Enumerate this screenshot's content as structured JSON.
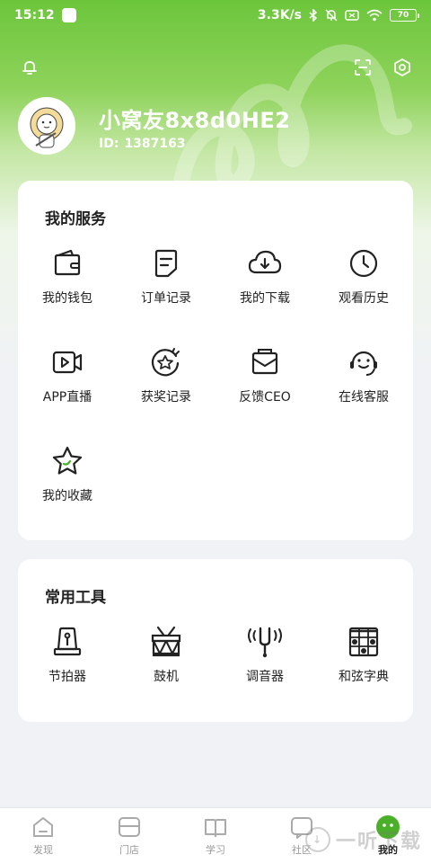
{
  "status_bar": {
    "time": "15:12",
    "network_speed": "3.3K/s",
    "battery": "70",
    "icons": [
      "app-notification-icon",
      "bluetooth-icon",
      "mute-icon",
      "sim-icon",
      "wifi-icon",
      "battery-icon"
    ]
  },
  "header": {
    "icons": [
      "bell-icon",
      "scan-icon",
      "settings-icon"
    ]
  },
  "profile": {
    "username": "小窝友8x8d0HE2",
    "id_label": "ID:",
    "id_value": "1387163"
  },
  "services": {
    "title": "我的服务",
    "items": [
      {
        "label": "我的钱包",
        "icon": "wallet-icon"
      },
      {
        "label": "订单记录",
        "icon": "order-icon"
      },
      {
        "label": "我的下载",
        "icon": "download-icon"
      },
      {
        "label": "观看历史",
        "icon": "history-icon"
      },
      {
        "label": "APP直播",
        "icon": "live-icon"
      },
      {
        "label": "获奖记录",
        "icon": "award-icon"
      },
      {
        "label": "反馈CEO",
        "icon": "feedback-icon"
      },
      {
        "label": "在线客服",
        "icon": "support-icon"
      },
      {
        "label": "我的收藏",
        "icon": "favorite-icon"
      }
    ]
  },
  "tools": {
    "title": "常用工具",
    "items": [
      {
        "label": "节拍器",
        "icon": "metronome-icon"
      },
      {
        "label": "鼓机",
        "icon": "drum-icon"
      },
      {
        "label": "调音器",
        "icon": "tuner-icon"
      },
      {
        "label": "和弦字典",
        "icon": "chord-icon"
      }
    ]
  },
  "bottom_nav": {
    "items": [
      {
        "label": "发现",
        "icon": "discover-icon",
        "active": false
      },
      {
        "label": "门店",
        "icon": "store-icon",
        "active": false
      },
      {
        "label": "学习",
        "icon": "study-icon",
        "active": false
      },
      {
        "label": "社区",
        "icon": "community-icon",
        "active": false
      },
      {
        "label": "我的",
        "icon": "profile-icon",
        "active": true
      }
    ]
  },
  "watermark": {
    "text": "一听下载"
  },
  "colors": {
    "brand_green": "#6cc63b",
    "active_green": "#4caf2a",
    "text_dark": "#222222",
    "muted": "#999999"
  }
}
